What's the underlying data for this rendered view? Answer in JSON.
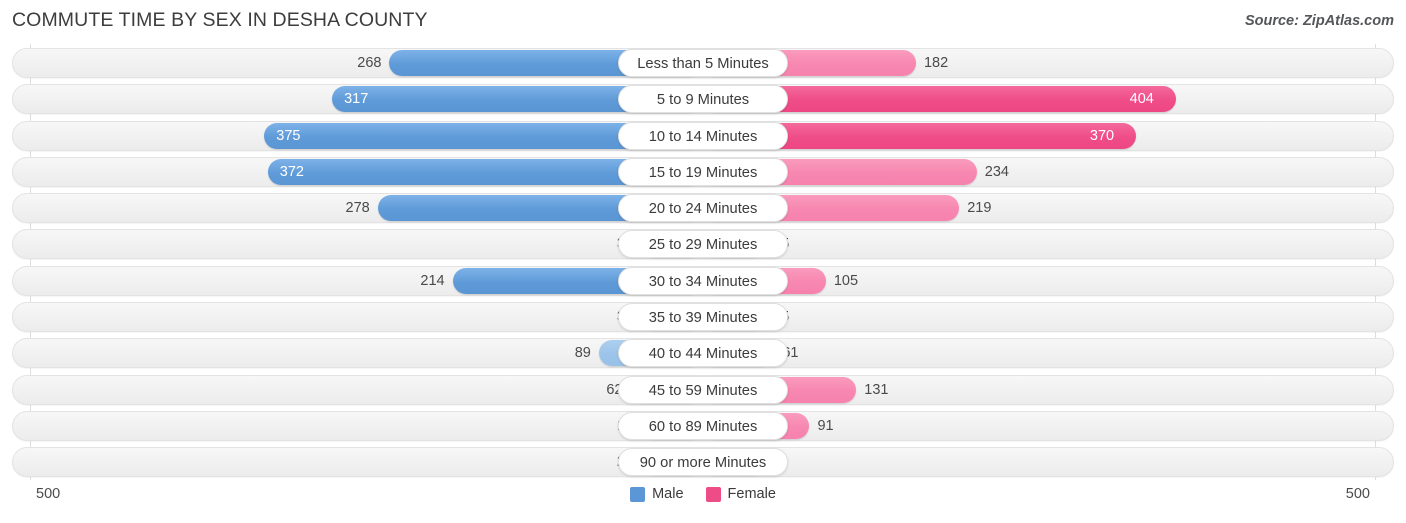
{
  "header": {
    "title": "COMMUTE TIME BY SEX IN DESHA COUNTY",
    "source": "Source: ZipAtlas.com"
  },
  "axis": {
    "left_label": "500",
    "right_label": "500",
    "max": 500
  },
  "legend": {
    "male_label": "Male",
    "female_label": "Female",
    "male_color": "#5b97d6",
    "female_color": "#ee4c87"
  },
  "chart_data": {
    "type": "bar",
    "orientation": "horizontal-diverging",
    "title": "COMMUTE TIME BY SEX IN DESHA COUNTY",
    "xlabel": "",
    "ylabel": "",
    "xlim": [
      500,
      500
    ],
    "grid": true,
    "legend_position": "bottom-center",
    "categories": [
      "Less than 5 Minutes",
      "5 to 9 Minutes",
      "10 to 14 Minutes",
      "15 to 19 Minutes",
      "20 to 24 Minutes",
      "25 to 29 Minutes",
      "30 to 34 Minutes",
      "35 to 39 Minutes",
      "40 to 44 Minutes",
      "45 to 59 Minutes",
      "60 to 89 Minutes",
      "90 or more Minutes"
    ],
    "series": [
      {
        "name": "Male",
        "values": [
          268,
          317,
          375,
          372,
          278,
          32,
          214,
          31,
          89,
          62,
          17,
          28
        ]
      },
      {
        "name": "Female",
        "values": [
          182,
          404,
          370,
          234,
          219,
          25,
          105,
          35,
          61,
          131,
          91,
          0
        ]
      }
    ]
  },
  "rows": [
    {
      "label": "Less than 5 Minutes",
      "male": 268,
      "female": 182,
      "male_text": "268",
      "female_text": "182",
      "male_inside": false,
      "female_inside": false,
      "male_tone": "normal",
      "female_tone": "pale"
    },
    {
      "label": "5 to 9 Minutes",
      "male": 317,
      "female": 404,
      "male_text": "317",
      "female_text": "404",
      "male_inside": true,
      "female_inside": true,
      "male_tone": "normal",
      "female_tone": "normal"
    },
    {
      "label": "10 to 14 Minutes",
      "male": 375,
      "female": 370,
      "male_text": "375",
      "female_text": "370",
      "male_inside": true,
      "female_inside": true,
      "male_tone": "normal",
      "female_tone": "normal"
    },
    {
      "label": "15 to 19 Minutes",
      "male": 372,
      "female": 234,
      "male_text": "372",
      "female_text": "234",
      "male_inside": true,
      "female_inside": false,
      "male_tone": "normal",
      "female_tone": "pale"
    },
    {
      "label": "20 to 24 Minutes",
      "male": 278,
      "female": 219,
      "male_text": "278",
      "female_text": "219",
      "male_inside": false,
      "female_inside": false,
      "male_tone": "normal",
      "female_tone": "pale"
    },
    {
      "label": "25 to 29 Minutes",
      "male": 32,
      "female": 25,
      "male_text": "32",
      "female_text": "25",
      "male_inside": false,
      "female_inside": false,
      "male_tone": "pale",
      "female_tone": "pale"
    },
    {
      "label": "30 to 34 Minutes",
      "male": 214,
      "female": 105,
      "male_text": "214",
      "female_text": "105",
      "male_inside": false,
      "female_inside": false,
      "male_tone": "normal",
      "female_tone": "pale"
    },
    {
      "label": "35 to 39 Minutes",
      "male": 31,
      "female": 35,
      "male_text": "31",
      "female_text": "35",
      "male_inside": false,
      "female_inside": false,
      "male_tone": "pale",
      "female_tone": "pale"
    },
    {
      "label": "40 to 44 Minutes",
      "male": 89,
      "female": 61,
      "male_text": "89",
      "female_text": "61",
      "male_inside": false,
      "female_inside": false,
      "male_tone": "pale",
      "female_tone": "pale"
    },
    {
      "label": "45 to 59 Minutes",
      "male": 62,
      "female": 131,
      "male_text": "62",
      "female_text": "131",
      "male_inside": false,
      "female_inside": false,
      "male_tone": "pale",
      "female_tone": "pale"
    },
    {
      "label": "60 to 89 Minutes",
      "male": 17,
      "female": 91,
      "male_text": "17",
      "female_text": "91",
      "male_inside": false,
      "female_inside": false,
      "male_tone": "pale",
      "female_tone": "pale"
    },
    {
      "label": "90 or more Minutes",
      "male": 28,
      "female": 0,
      "male_text": "28",
      "female_text": "0",
      "male_inside": false,
      "female_inside": false,
      "male_tone": "pale",
      "female_tone": "palest"
    }
  ]
}
